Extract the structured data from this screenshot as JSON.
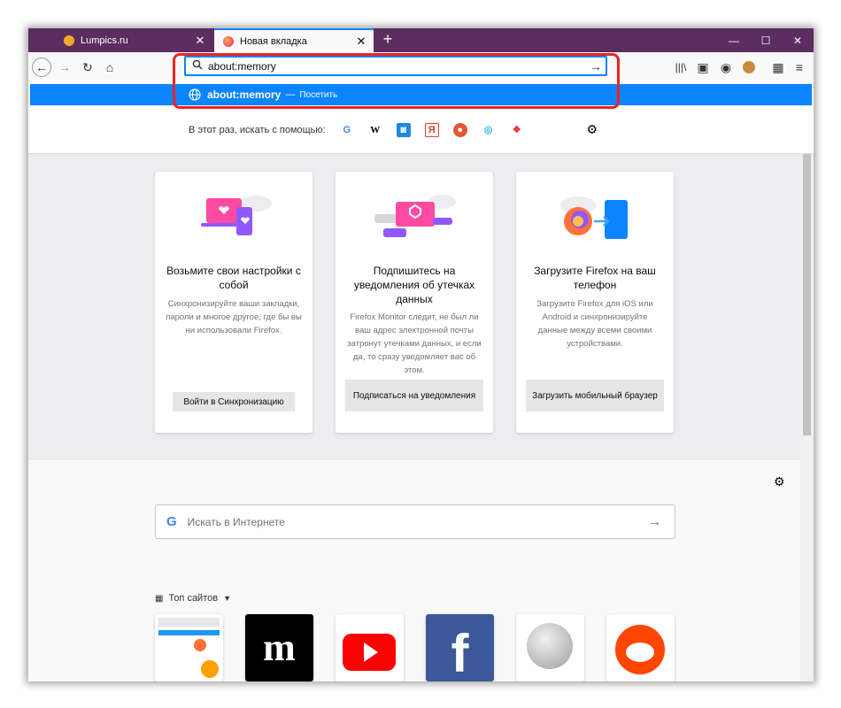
{
  "tabs": [
    {
      "title": "Lumpics.ru",
      "icon": "lumpics-favicon"
    },
    {
      "title": "Новая вкладка",
      "icon": "firefox-favicon"
    }
  ],
  "urlbar": {
    "value": "about:memory"
  },
  "suggestion": {
    "text": "about:memory",
    "sep": "—",
    "action": "Посетить"
  },
  "one_off": {
    "label": "В этот раз, искать с помощью:"
  },
  "cards": [
    {
      "title": "Возьмите свои настройки с собой",
      "body": "Синхронизируйте ваши закладки, пароли и многое другое, где бы вы ни использовали Firefox.",
      "button": "Войти в Синхронизацию"
    },
    {
      "title": "Подпишитесь на уведомления об утечках данных",
      "body": "Firefox Monitor следит, не был ли ваш адрес электронной почты затронут утечками данных, и если да, то сразу уведомляет вас об этом.",
      "button": "Подписаться на уведомления"
    },
    {
      "title": "Загрузите Firefox на ваш телефон",
      "body": "Загрузите Firefox для iOS или Android и синхронизируйте данные между всеми своими устройствами.",
      "button": "Загрузить мобильный браузер"
    }
  ],
  "search": {
    "placeholder": "Искать в Интернете"
  },
  "topsites": {
    "label": "Топ сайтов"
  },
  "colors": {
    "titlebar": "#5b2d60",
    "accent": "#0a84ff",
    "highlight": "#e22222"
  }
}
